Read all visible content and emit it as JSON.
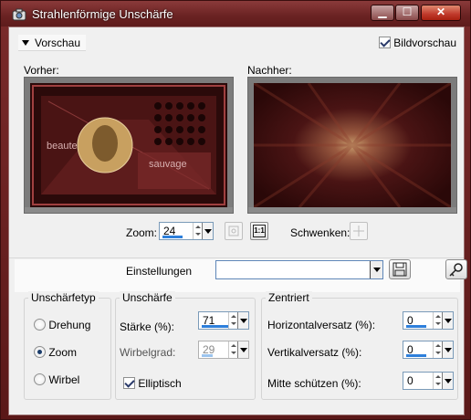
{
  "window": {
    "title": "Strahlenförmige Unschärfe"
  },
  "titlebar": {
    "minimize_glyph": "▁",
    "maximize_glyph": "☐",
    "close_glyph": "✕"
  },
  "preview_bar": {
    "toggle_label": "Vorschau",
    "bildvorschau_label": "Bildvorschau",
    "bildvorschau_checked": true
  },
  "before": {
    "label": "Vorher:",
    "thumb_text_1": "beaute",
    "thumb_text_2": "sauvage"
  },
  "after": {
    "label": "Nachher:"
  },
  "zoom": {
    "label": "Zoom:",
    "value": "24",
    "one_to_one_label": "1:1"
  },
  "pan": {
    "label": "Schwenken:"
  },
  "settings": {
    "label": "Einstellungen",
    "value": ""
  },
  "blur_type": {
    "title": "Unschärfetyp",
    "options": [
      "Drehung",
      "Zoom",
      "Wirbel"
    ],
    "selected": "Zoom"
  },
  "blur": {
    "title": "Unschärfe",
    "strength_label": "Stärke (%):",
    "strength_value": "71",
    "twist_label": "Wirbelgrad:",
    "twist_value": "29",
    "elliptic_label": "Elliptisch",
    "elliptic_checked": true
  },
  "center": {
    "title": "Zentriert",
    "h_offset_label": "Horizontalversatz (%):",
    "h_offset_value": "0",
    "v_offset_label": "Vertikalversatz (%):",
    "v_offset_value": "0",
    "protect_label": "Mitte schützen (%):",
    "protect_value": "0"
  }
}
